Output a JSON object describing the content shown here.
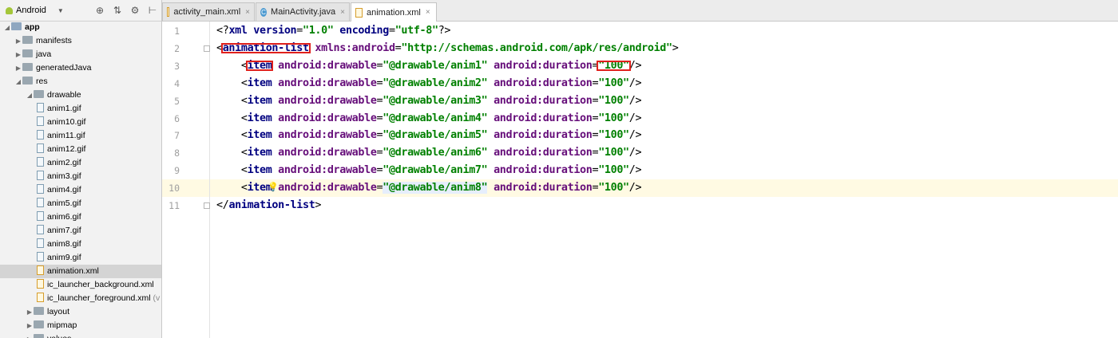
{
  "panel": {
    "view_mode": "Android",
    "tree": [
      {
        "label": "app",
        "type": "module",
        "depth": 0,
        "arrow": "open"
      },
      {
        "label": "manifests",
        "type": "folder",
        "depth": 1,
        "arrow": "closed"
      },
      {
        "label": "java",
        "type": "folder",
        "depth": 1,
        "arrow": "closed"
      },
      {
        "label": "generatedJava",
        "type": "folder",
        "depth": 1,
        "arrow": "closed"
      },
      {
        "label": "res",
        "type": "folder",
        "depth": 1,
        "arrow": "open"
      },
      {
        "label": "drawable",
        "type": "folder",
        "depth": 2,
        "arrow": "open"
      },
      {
        "label": "anim1.gif",
        "type": "gif",
        "depth": 3
      },
      {
        "label": "anim10.gif",
        "type": "gif",
        "depth": 3
      },
      {
        "label": "anim11.gif",
        "type": "gif",
        "depth": 3
      },
      {
        "label": "anim12.gif",
        "type": "gif",
        "depth": 3
      },
      {
        "label": "anim2.gif",
        "type": "gif",
        "depth": 3
      },
      {
        "label": "anim3.gif",
        "type": "gif",
        "depth": 3
      },
      {
        "label": "anim4.gif",
        "type": "gif",
        "depth": 3
      },
      {
        "label": "anim5.gif",
        "type": "gif",
        "depth": 3
      },
      {
        "label": "anim6.gif",
        "type": "gif",
        "depth": 3
      },
      {
        "label": "anim7.gif",
        "type": "gif",
        "depth": 3
      },
      {
        "label": "anim8.gif",
        "type": "gif",
        "depth": 3
      },
      {
        "label": "anim9.gif",
        "type": "gif",
        "depth": 3
      },
      {
        "label": "animation.xml",
        "type": "xml",
        "depth": 3,
        "selected": true
      },
      {
        "label": "ic_launcher_background.xml",
        "type": "xml",
        "depth": 3
      },
      {
        "label": "ic_launcher_foreground.xml",
        "type": "xml",
        "depth": 3,
        "suffix": "(v"
      },
      {
        "label": "layout",
        "type": "folder",
        "depth": 2,
        "arrow": "closed"
      },
      {
        "label": "mipmap",
        "type": "folder",
        "depth": 2,
        "arrow": "closed"
      },
      {
        "label": "values",
        "type": "folder",
        "depth": 2,
        "arrow": "closed"
      }
    ]
  },
  "tabs": [
    {
      "label": "activity_main.xml",
      "icon": "xml-file-icon",
      "active": false
    },
    {
      "label": "MainActivity.java",
      "icon": "java-class-icon",
      "active": false
    },
    {
      "label": "animation.xml",
      "icon": "xml-file-icon",
      "active": true
    }
  ],
  "editor": {
    "current_line": 10,
    "lines": [
      {
        "n": "1",
        "tokens": [
          [
            "br",
            "<?"
          ],
          [
            "pi",
            "xml version"
          ],
          [
            "br",
            "="
          ],
          [
            "va",
            "\"1.0\""
          ],
          [
            "br",
            " "
          ],
          [
            "pi",
            "encoding"
          ],
          [
            "br",
            "="
          ],
          [
            "va",
            "\"utf-8\""
          ],
          [
            "br",
            "?>"
          ]
        ]
      },
      {
        "n": "2",
        "tokens": [
          [
            "br",
            "<"
          ],
          [
            "tg",
            "animation-list"
          ],
          [
            "br",
            " "
          ],
          [
            "at",
            "xmlns:android"
          ],
          [
            "br",
            "="
          ],
          [
            "va",
            "\"http://schemas.android.com/apk/res/android\""
          ],
          [
            "br",
            ">"
          ]
        ]
      },
      {
        "n": "3",
        "tokens": [
          [
            "br",
            "    <"
          ],
          [
            "tg",
            "item"
          ],
          [
            "br",
            " "
          ],
          [
            "at",
            "android:drawable"
          ],
          [
            "br",
            "="
          ],
          [
            "va",
            "\"@drawable/anim1\""
          ],
          [
            "br",
            " "
          ],
          [
            "at",
            "android:duration"
          ],
          [
            "br",
            "="
          ],
          [
            "va",
            "\"100\""
          ],
          [
            "br",
            "/>"
          ]
        ]
      },
      {
        "n": "4",
        "tokens": [
          [
            "br",
            "    <"
          ],
          [
            "tg",
            "item"
          ],
          [
            "br",
            " "
          ],
          [
            "at",
            "android:drawable"
          ],
          [
            "br",
            "="
          ],
          [
            "va",
            "\"@drawable/anim2\""
          ],
          [
            "br",
            " "
          ],
          [
            "at",
            "android:duration"
          ],
          [
            "br",
            "="
          ],
          [
            "va",
            "\"100\""
          ],
          [
            "br",
            "/>"
          ]
        ]
      },
      {
        "n": "5",
        "tokens": [
          [
            "br",
            "    <"
          ],
          [
            "tg",
            "item"
          ],
          [
            "br",
            " "
          ],
          [
            "at",
            "android:drawable"
          ],
          [
            "br",
            "="
          ],
          [
            "va",
            "\"@drawable/anim3\""
          ],
          [
            "br",
            " "
          ],
          [
            "at",
            "android:duration"
          ],
          [
            "br",
            "="
          ],
          [
            "va",
            "\"100\""
          ],
          [
            "br",
            "/>"
          ]
        ]
      },
      {
        "n": "6",
        "tokens": [
          [
            "br",
            "    <"
          ],
          [
            "tg",
            "item"
          ],
          [
            "br",
            " "
          ],
          [
            "at",
            "android:drawable"
          ],
          [
            "br",
            "="
          ],
          [
            "va",
            "\"@drawable/anim4\""
          ],
          [
            "br",
            " "
          ],
          [
            "at",
            "android:duration"
          ],
          [
            "br",
            "="
          ],
          [
            "va",
            "\"100\""
          ],
          [
            "br",
            "/>"
          ]
        ]
      },
      {
        "n": "7",
        "tokens": [
          [
            "br",
            "    <"
          ],
          [
            "tg",
            "item"
          ],
          [
            "br",
            " "
          ],
          [
            "at",
            "android:drawable"
          ],
          [
            "br",
            "="
          ],
          [
            "va",
            "\"@drawable/anim5\""
          ],
          [
            "br",
            " "
          ],
          [
            "at",
            "android:duration"
          ],
          [
            "br",
            "="
          ],
          [
            "va",
            "\"100\""
          ],
          [
            "br",
            "/>"
          ]
        ]
      },
      {
        "n": "8",
        "tokens": [
          [
            "br",
            "    <"
          ],
          [
            "tg",
            "item"
          ],
          [
            "br",
            " "
          ],
          [
            "at",
            "android:drawable"
          ],
          [
            "br",
            "="
          ],
          [
            "va",
            "\"@drawable/anim6\""
          ],
          [
            "br",
            " "
          ],
          [
            "at",
            "android:duration"
          ],
          [
            "br",
            "="
          ],
          [
            "va",
            "\"100\""
          ],
          [
            "br",
            "/>"
          ]
        ]
      },
      {
        "n": "9",
        "tokens": [
          [
            "br",
            "    <"
          ],
          [
            "tg",
            "item"
          ],
          [
            "br",
            " "
          ],
          [
            "at",
            "android:drawable"
          ],
          [
            "br",
            "="
          ],
          [
            "va",
            "\"@drawable/anim7\""
          ],
          [
            "br",
            " "
          ],
          [
            "at",
            "android:duration"
          ],
          [
            "br",
            "="
          ],
          [
            "va",
            "\"100\""
          ],
          [
            "br",
            "/>"
          ]
        ]
      },
      {
        "n": "10",
        "tokens": [
          [
            "br",
            "    <"
          ],
          [
            "tg",
            "item"
          ],
          [
            "br",
            " "
          ],
          [
            "at",
            "android:drawable"
          ],
          [
            "br",
            "="
          ],
          [
            "va",
            "\"@drawable/anim8\""
          ],
          [
            "br",
            " "
          ],
          [
            "at",
            "android:duration"
          ],
          [
            "br",
            "="
          ],
          [
            "va",
            "\"100\""
          ],
          [
            "br",
            "/>"
          ]
        ]
      },
      {
        "n": "11",
        "tokens": [
          [
            "br",
            "</"
          ],
          [
            "tg",
            "animation-list"
          ],
          [
            "br",
            ">"
          ]
        ]
      }
    ]
  },
  "colors": {
    "highlight_box": "#e0201c",
    "current_line_bg": "#fffae3",
    "selection_bg": "#d4d4d4"
  }
}
